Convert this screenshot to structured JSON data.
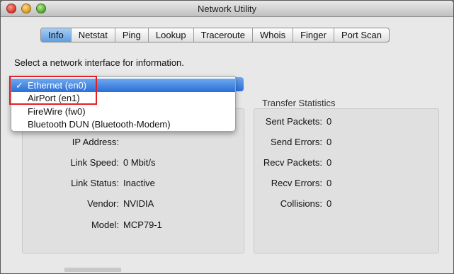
{
  "window": {
    "title": "Network Utility"
  },
  "tabs": [
    {
      "label": "Info"
    },
    {
      "label": "Netstat"
    },
    {
      "label": "Ping"
    },
    {
      "label": "Lookup"
    },
    {
      "label": "Traceroute"
    },
    {
      "label": "Whois"
    },
    {
      "label": "Finger"
    },
    {
      "label": "Port Scan"
    }
  ],
  "info": {
    "prompt": "Select a network interface for information.",
    "interface_menu": {
      "check": "✓",
      "items": [
        {
          "label": "Ethernet (en0)"
        },
        {
          "label": "AirPort (en1)"
        },
        {
          "label": "FireWire (fw0)"
        },
        {
          "label": "Bluetooth DUN (Bluetooth-Modem)"
        }
      ]
    },
    "interface_info": {
      "ip_address_label": "IP Address:",
      "ip_address_value": "",
      "link_speed_label": "Link Speed:",
      "link_speed_value": "0 Mbit/s",
      "link_status_label": "Link Status:",
      "link_status_value": "Inactive",
      "vendor_label": "Vendor:",
      "vendor_value": "NVIDIA",
      "model_label": "Model:",
      "model_value": "MCP79-1"
    },
    "transfer_statistics": {
      "title": "Transfer Statistics",
      "sent_packets_label": "Sent Packets:",
      "sent_packets_value": "0",
      "send_errors_label": "Send Errors:",
      "send_errors_value": "0",
      "recv_packets_label": "Recv Packets:",
      "recv_packets_value": "0",
      "recv_errors_label": "Recv Errors:",
      "recv_errors_value": "0",
      "collisions_label": "Collisions:",
      "collisions_value": "0"
    }
  },
  "colors": {
    "selection": "#2a6ed8",
    "highlight_box": "#e41f22"
  }
}
